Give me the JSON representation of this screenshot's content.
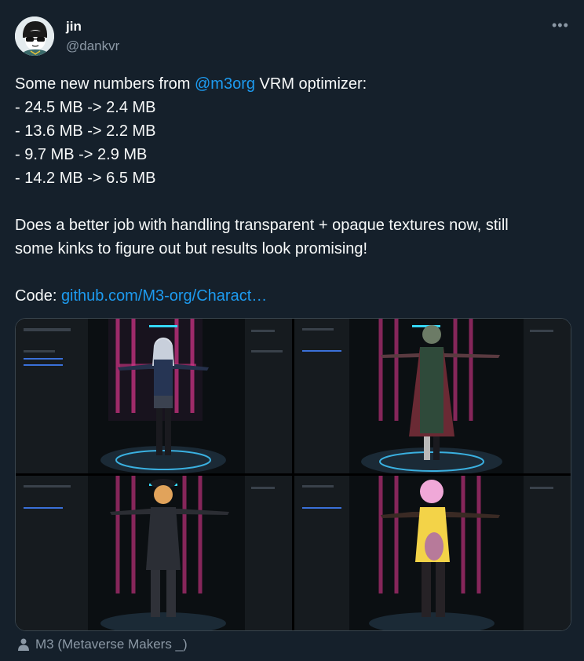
{
  "author": {
    "name": "jin",
    "handle": "@dankvr",
    "avatar_icon": "cartoon-avatar-with-sunglasses"
  },
  "tweet": {
    "intro_before": "Some new numbers from ",
    "mention": "@m3org",
    "intro_after": " VRM optimizer:",
    "results": [
      "- 24.5 MB -> 2.4 MB",
      "- 13.6 MB -> 2.2 MB",
      "- 9.7 MB -> 2.9 MB",
      "- 14.2 MB -> 6.5 MB"
    ],
    "paragraph": [
      "Does a better job with handling transparent + opaque textures now, still",
      "some kinks to figure out but results look promising!"
    ],
    "code_label": "Code: ",
    "code_link": "github.com/M3-org/Charact…"
  },
  "media": {
    "panels": [
      {
        "character": "silver-haired girl in school uniform"
      },
      {
        "character": "green-haired character in dark red robe"
      },
      {
        "character": "orange-haired character in black military outfit"
      },
      {
        "character": "pink-haired character with yellow top"
      }
    ]
  },
  "community": {
    "label": "M3 (Metaverse Makers _)",
    "icon": "person-icon"
  },
  "colors": {
    "background": "#15202b",
    "text": "#f7f9f9",
    "muted": "#8b98a5",
    "link": "#1d9bf0"
  }
}
